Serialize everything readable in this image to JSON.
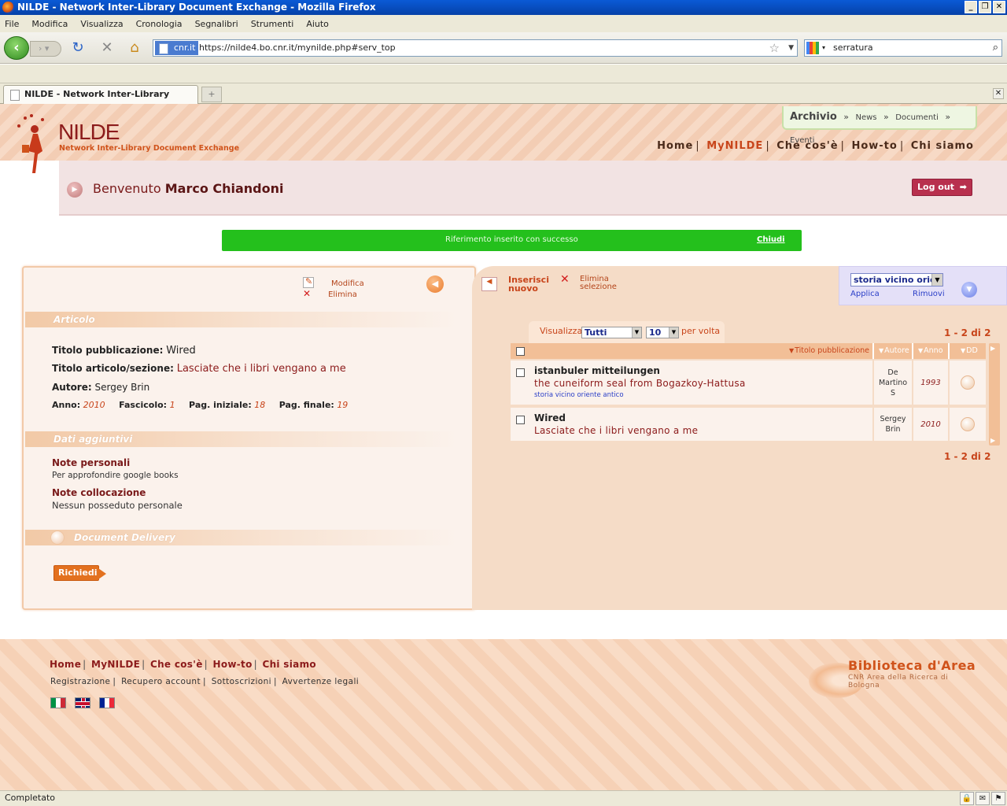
{
  "window": {
    "title": "NILDE - Network Inter-Library Document Exchange - Mozilla Firefox"
  },
  "menu": [
    "File",
    "Modifica",
    "Visualizza",
    "Cronologia",
    "Segnalibri",
    "Strumenti",
    "Aiuto"
  ],
  "nav": {
    "site_label": "cnr.it",
    "url": "https://nilde4.bo.cnr.it/mynilde.php#serv_top",
    "search_value": "serratura"
  },
  "tab": {
    "label": "NILDE - Network Inter-Library Docu..."
  },
  "header": {
    "logo_name": "NILDE",
    "logo_sub": "Network Inter-Library Document Exchange",
    "archivio": "Archivio",
    "archivio_links": [
      "News",
      "Documenti",
      "Eventi"
    ],
    "topnav": [
      "Home",
      "MyNILDE",
      "Che cos'è",
      "How-to",
      "Chi siamo"
    ]
  },
  "welcome": {
    "prefix": "Benvenuto",
    "user": "Marco Chiandoni",
    "logout": "Log out"
  },
  "success": {
    "message": "Riferimento inserito con successo",
    "close": "Chiudi"
  },
  "detail": {
    "edit": "Modifica",
    "delete": "Elimina",
    "section_articolo": "Articolo",
    "titolo_pub_label": "Titolo pubblicazione:",
    "titolo_pub_value": "Wired",
    "titolo_art_label": "Titolo articolo/sezione:",
    "titolo_art_value": "Lasciate che i libri vengano a me",
    "autore_label": "Autore:",
    "autore_value": "Sergey Brin",
    "anno_label": "Anno:",
    "anno_value": "2010",
    "fascicolo_label": "Fascicolo:",
    "fascicolo_value": "1",
    "pag_iniz_label": "Pag. iniziale:",
    "pag_iniz_value": "18",
    "pag_fin_label": "Pag. finale:",
    "pag_fin_value": "19",
    "section_dati": "Dati aggiuntivi",
    "note_personali_label": "Note personali",
    "note_personali_value": "Per approfondire google books",
    "note_coll_label": "Note collocazione",
    "note_coll_value": "Nessun posseduto personale",
    "section_dd": "Document Delivery",
    "richiedi": "Richiedi"
  },
  "list": {
    "insert_l1": "Inserisci",
    "insert_l2": "nuovo",
    "delsel_l1": "Elimina",
    "delsel_l2": "selezione",
    "filter_value": "storia vicino orien",
    "apply": "Applica",
    "remove": "Rimuovi",
    "visualizza_label": "Visualizza",
    "visualizza_value": "Tutti",
    "per_page_value": "10",
    "per_volta": "per volta",
    "pager": "1 - 2 di 2",
    "columns": [
      "Titolo pubblicazione",
      "Autore",
      "Anno",
      "DD"
    ],
    "rows": [
      {
        "title": "istanbuler mitteilungen",
        "subtitle": "the cuneiform seal from Bogazkoy-Hattusa",
        "tag": "storia vicino oriente antico",
        "author": "De Martino S",
        "year": "1993"
      },
      {
        "title": "Wired",
        "subtitle": "Lasciate che i libri vengano a me",
        "tag": "",
        "author": "Sergey Brin",
        "year": "2010"
      }
    ]
  },
  "footer": {
    "nav": [
      "Home",
      "MyNILDE",
      "Che cos'è",
      "How-to",
      "Chi siamo"
    ],
    "links": [
      "Registrazione",
      "Recupero account",
      "Sottoscrizioni",
      "Avvertenze legali"
    ],
    "bda_title": "Biblioteca d'Area",
    "bda_sub": "CNR Area della Ricerca di Bologna"
  },
  "status": {
    "text": "Completato"
  }
}
